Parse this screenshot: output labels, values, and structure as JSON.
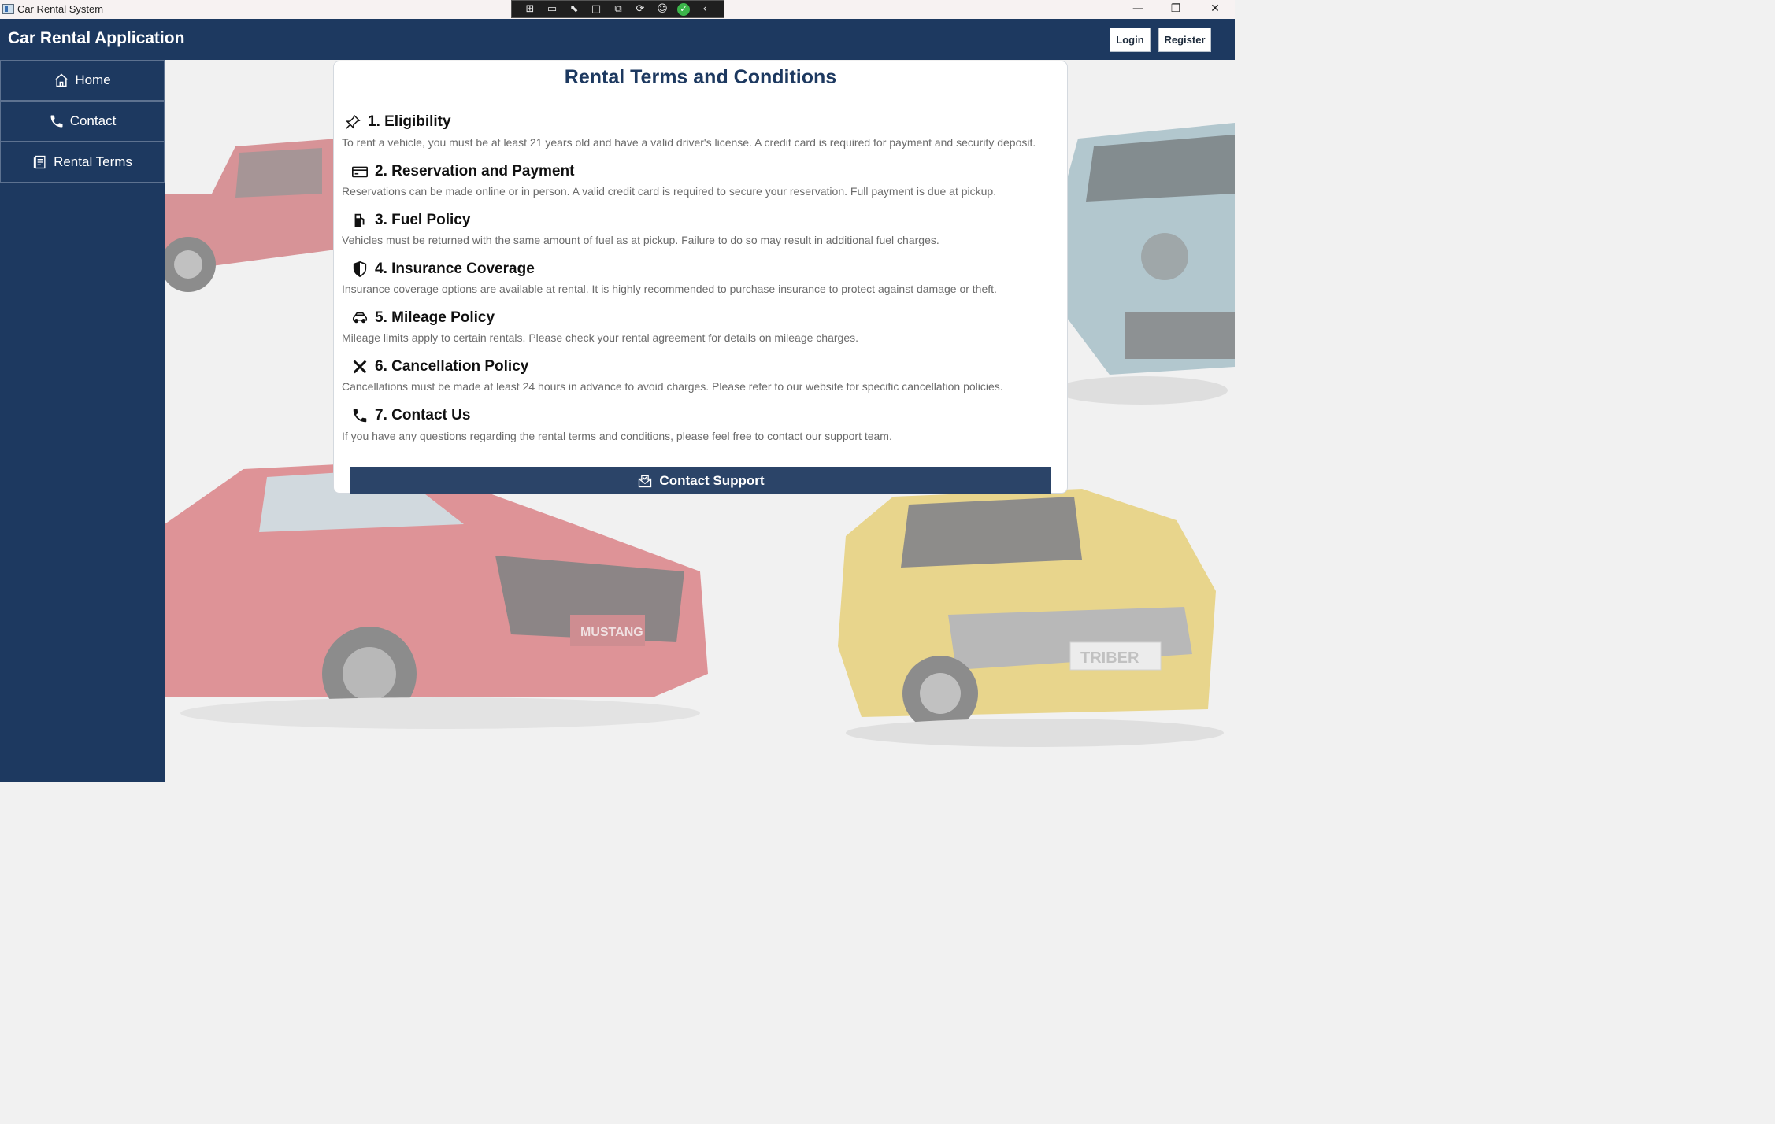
{
  "window": {
    "title": "Car Rental System",
    "controls": {
      "minimize": "—",
      "restore": "❐",
      "close": "✕"
    }
  },
  "debug_toolbar": {
    "icons": [
      "live-visual-tree-icon",
      "record-icon",
      "select-element-icon",
      "layout-adorner-icon",
      "track-focus-icon",
      "hot-reload-icon",
      "accessibility-icon",
      "check-icon",
      "collapse-icon"
    ]
  },
  "header": {
    "brand": "Car Rental Application",
    "login_label": "Login",
    "register_label": "Register"
  },
  "sidebar": {
    "items": [
      {
        "label": "Home",
        "icon": "home-icon"
      },
      {
        "label": "Contact",
        "icon": "phone-icon"
      },
      {
        "label": "Rental Terms",
        "icon": "document-icon"
      }
    ]
  },
  "background": {
    "car_badges": [
      "MUSTANG",
      "TRIBER"
    ]
  },
  "terms": {
    "title": "Rental Terms and Conditions",
    "sections": [
      {
        "heading": "1. Eligibility",
        "icon": "pin-icon",
        "text": "To rent a vehicle, you must be at least 21 years old and have a valid driver's license. A credit card is required for payment and security deposit."
      },
      {
        "heading": "2. Reservation and Payment",
        "icon": "credit-card-icon",
        "text": "Reservations can be made online or in person. A valid credit card is required to secure your reservation. Full payment is due at pickup."
      },
      {
        "heading": "3. Fuel Policy",
        "icon": "fuel-pump-icon",
        "text": "Vehicles must be returned with the same amount of fuel as at pickup. Failure to do so may result in additional fuel charges."
      },
      {
        "heading": "4. Insurance Coverage",
        "icon": "shield-icon",
        "text": "Insurance coverage options are available at rental. It is highly recommended to purchase insurance to protect against damage or theft."
      },
      {
        "heading": "5. Mileage Policy",
        "icon": "car-icon",
        "text": "Mileage limits apply to certain rentals. Please check your rental agreement for details on mileage charges."
      },
      {
        "heading": "6. Cancellation Policy",
        "icon": "close-icon",
        "text": "Cancellations must be made at least 24 hours in advance to avoid charges. Please refer to our website for specific cancellation policies."
      },
      {
        "heading": "7. Contact Us",
        "icon": "phone-icon",
        "text": "If you have any questions regarding the rental terms and conditions, please feel free to contact our support team."
      }
    ],
    "button_label": "Contact Support",
    "button_icon": "mail-icon"
  }
}
